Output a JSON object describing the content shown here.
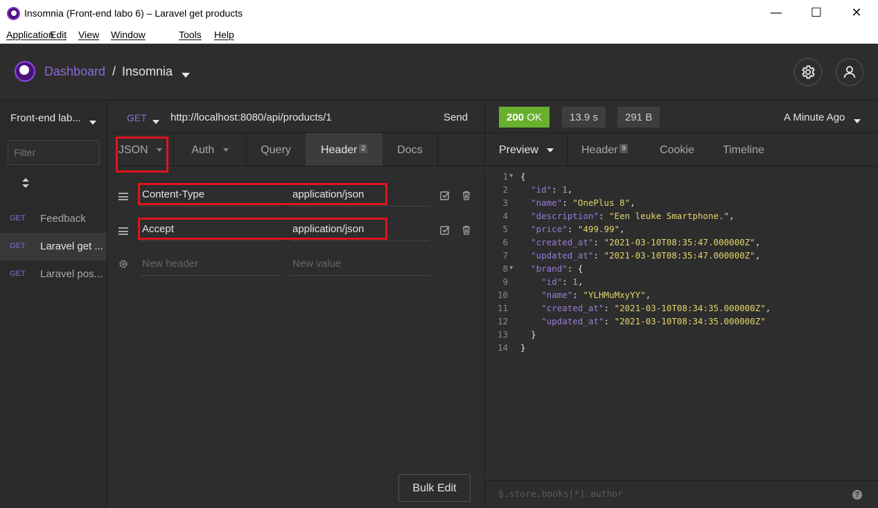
{
  "window": {
    "title": "Insomnia (Front-end labo 6) – Laravel get products",
    "controls": [
      "—",
      "☐",
      "✕"
    ]
  },
  "menu": [
    "Application",
    "Edit",
    "View",
    "Window",
    "Tools",
    "Help"
  ],
  "header": {
    "dashboard": "Dashboard",
    "separator": "/",
    "workspace": "Insomnia"
  },
  "sidebar": {
    "workspace_name": "Front-end lab...",
    "filter_placeholder": "Filter",
    "requests": [
      {
        "method": "GET",
        "name": "Feedback",
        "active": false
      },
      {
        "method": "GET",
        "name": "Laravel get ...",
        "active": true
      },
      {
        "method": "GET",
        "name": "Laravel pos...",
        "active": false
      }
    ]
  },
  "request": {
    "method": "GET",
    "url": "http://localhost:8080/api/products/1",
    "send_label": "Send",
    "tabs": [
      {
        "label": "JSON"
      },
      {
        "label": "Auth"
      },
      {
        "label": "Query"
      },
      {
        "label": "Header",
        "badge": "2"
      },
      {
        "label": "Docs"
      }
    ],
    "headers": [
      {
        "name": "Content-Type",
        "value": "application/json"
      },
      {
        "name": "Accept",
        "value": "application/json"
      }
    ],
    "new_header_placeholder": "New header",
    "new_value_placeholder": "New value",
    "bulk_edit_label": "Bulk Edit"
  },
  "response": {
    "status": "200",
    "status_text": "OK",
    "time": "13.9 s",
    "size": "291 B",
    "ago": "A Minute Ago",
    "status_color": "#68b02d",
    "tabs": [
      {
        "label": "Preview"
      },
      {
        "label": "Header",
        "badge": "9"
      },
      {
        "label": "Cookie"
      },
      {
        "label": "Timeline"
      }
    ],
    "line_numbers": [
      "1",
      "2",
      "3",
      "4",
      "5",
      "6",
      "7",
      "8",
      "9",
      "10",
      "11",
      "12",
      "13",
      "14"
    ],
    "body": {
      "id": "1",
      "name": "\"OnePlus 8\"",
      "description": "\"Een leuke Smartphone.\"",
      "price": "\"499.99\"",
      "created_at": "\"2021-03-10T08:35:47.000000Z\"",
      "updated_at": "\"2021-03-10T08:35:47.000000Z\"",
      "brand": {
        "id": "1",
        "name": "\"YLHMuMxyYY\"",
        "created_at": "\"2021-03-10T08:34:35.000000Z\"",
        "updated_at": "\"2021-03-10T08:34:35.000000Z\""
      }
    },
    "filter_placeholder": "$.store.books[*].author"
  },
  "colors": {
    "accent_purple": "#8b6ad8",
    "highlight_red": "#e0141e",
    "json_key": "#9b7bdf",
    "json_string": "#e4d56b"
  }
}
